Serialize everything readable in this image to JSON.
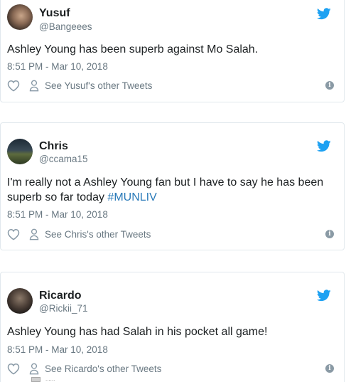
{
  "tweets": [
    {
      "author": "Yusuf",
      "handle": "@Bangeees",
      "text": "Ashley Young has been superb against Mo Salah.",
      "hashtag": "",
      "timestamp": "8:51 PM - Mar 10, 2018",
      "other_tweets_label": "See Yusuf's other Tweets"
    },
    {
      "author": "Chris",
      "handle": "@ccama15",
      "text": "I'm really not a Ashley Young fan but I have to say he has been superb so far today ",
      "hashtag": "#MUNLIV",
      "timestamp": "8:51 PM - Mar 10, 2018",
      "other_tweets_label": "See Chris's other Tweets"
    },
    {
      "author": "Ricardo",
      "handle": "@Rickii_71",
      "text": "Ashley Young has had Salah in his pocket all game!",
      "hashtag": "",
      "timestamp": "8:51 PM - Mar 10, 2018",
      "other_tweets_label": "See Ricardo's other Tweets"
    }
  ],
  "icons": {
    "brand": "twitter-bird-icon",
    "like": "heart-icon",
    "profile": "person-icon",
    "info": "info-icon"
  },
  "colors": {
    "twitter_blue": "#1da1f2",
    "hashtag": "#2b7bb9",
    "muted_text": "#697882",
    "border": "#e1e8ed"
  },
  "info_glyph": "i",
  "footer_peek_text": "......"
}
